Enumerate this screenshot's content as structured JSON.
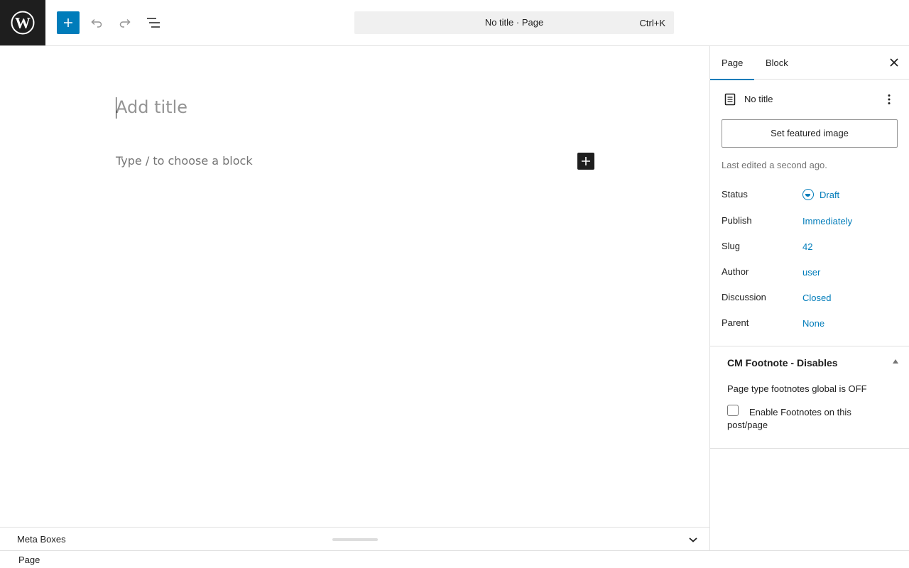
{
  "topbar": {
    "command_title": "No title · Page",
    "command_shortcut": "Ctrl+K"
  },
  "editor": {
    "title_placeholder": "Add title",
    "block_placeholder": "Type / to choose a block"
  },
  "metabar": {
    "label": "Meta Boxes"
  },
  "footer": {
    "breadcrumb": "Page"
  },
  "sidebar": {
    "tabs": [
      {
        "label": "Page",
        "active": true
      },
      {
        "label": "Block",
        "active": false
      }
    ],
    "post_title": "No title",
    "featured_button": "Set featured image",
    "last_edited": "Last edited a second ago.",
    "properties": [
      {
        "label": "Status",
        "value": "Draft"
      },
      {
        "label": "Publish",
        "value": "Immediately"
      },
      {
        "label": "Slug",
        "value": "42"
      },
      {
        "label": "Author",
        "value": "user"
      },
      {
        "label": "Discussion",
        "value": "Closed"
      },
      {
        "label": "Parent",
        "value": "None"
      }
    ],
    "panel": {
      "title": "CM Footnote - Disables",
      "note": "Page type footnotes global is OFF",
      "checkbox_label": "Enable Footnotes on this post/page",
      "checked": false
    }
  },
  "colors": {
    "accent": "#007cba",
    "dark": "#1e1e1e"
  }
}
